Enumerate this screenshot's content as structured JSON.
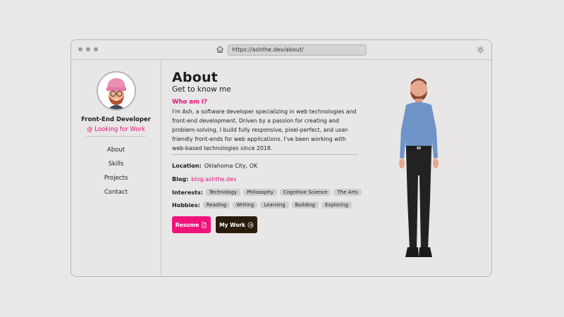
{
  "browser": {
    "url": "https://ashthe.dev/about/",
    "icons": [
      "home-icon",
      "sun-icon"
    ]
  },
  "sidebar": {
    "avatar_icon": "memoji-avatar",
    "role": "Front-End Developer",
    "status": "@ Looking for Work",
    "nav": [
      {
        "label": "About"
      },
      {
        "label": "Skills"
      },
      {
        "label": "Projects"
      },
      {
        "label": "Contact"
      }
    ]
  },
  "main": {
    "title": "About",
    "subtitle": "Get to know me",
    "who_heading": "Who am I?",
    "bio": "I'm Ash, a software developer specializing in web technologies and front-end development. Driven by a passion for creating and problem-solving, I build fully responsive, pixel-perfect, and user-friendly front-ends for web applications. I've been working with web-based technologies since 2018.",
    "location_label": "Location:",
    "location": "Oklahoma City, OK",
    "blog_label": "Blog:",
    "blog": "blog.ashthe.dev",
    "interests_label": "Interests:",
    "interests": [
      "Technology",
      "Philosophy",
      "Cognitive Science",
      "The Arts"
    ],
    "hobbies_label": "Hobbies:",
    "hobbies": [
      "Reading",
      "Writing",
      "Learning",
      "Building",
      "Exploring"
    ],
    "resume_label": "Resume",
    "work_label": "My Work"
  },
  "colors": {
    "accent": "#f0137c",
    "dark_button": "#2a1c0c",
    "background": "#e9e7e8"
  }
}
